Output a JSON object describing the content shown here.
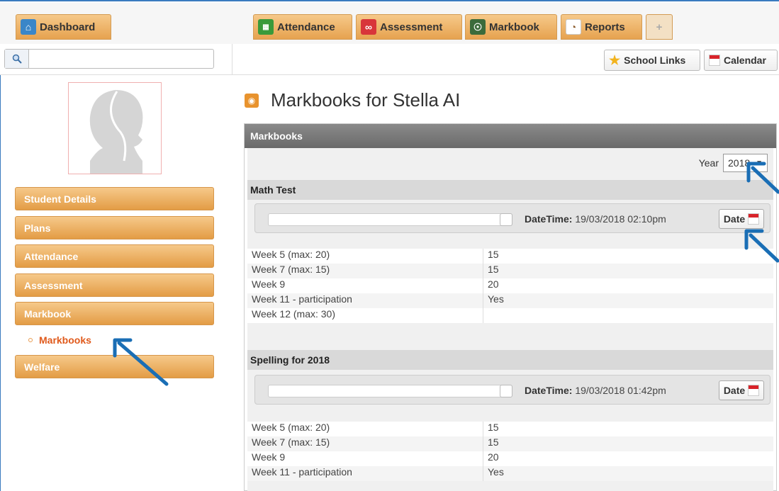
{
  "nav": {
    "dashboard": "Dashboard",
    "attendance": "Attendance",
    "assessment": "Assessment",
    "markbook": "Markbook",
    "reports": "Reports",
    "plus": "+"
  },
  "toolbar": {
    "search_value": "",
    "school_links": "School Links",
    "calendar": "Calendar"
  },
  "sidebar": {
    "items": [
      "Student Details",
      "Plans",
      "Attendance",
      "Assessment",
      "Markbook",
      "Welfare"
    ],
    "sub_item": "Markbooks"
  },
  "main": {
    "title": "Markbooks for Stella AI",
    "panel_title": "Markbooks",
    "year_label": "Year",
    "year_value": "2018",
    "markbooks": [
      {
        "title": "Math Test",
        "datetime_label": "DateTime:",
        "datetime_value": "19/03/2018 02:10pm",
        "date_button": "Date",
        "rows": [
          [
            "Week 5 (max: 20)",
            "15"
          ],
          [
            "Week 7 (max: 15)",
            "15"
          ],
          [
            "Week 9",
            "20"
          ],
          [
            "Week 11 - participation",
            "Yes"
          ],
          [
            "Week 12 (max: 30)",
            ""
          ]
        ]
      },
      {
        "title": "Spelling for 2018",
        "datetime_label": "DateTime:",
        "datetime_value": "19/03/2018 01:42pm",
        "date_button": "Date",
        "rows": [
          [
            "Week 5 (max: 20)",
            "15"
          ],
          [
            "Week 7 (max: 15)",
            "15"
          ],
          [
            "Week 9",
            "20"
          ],
          [
            "Week 11 - participation",
            "Yes"
          ]
        ]
      }
    ]
  },
  "colors": {
    "accent_orange": "#e6a24f",
    "active_link": "#e05a1c",
    "panel_header": "#6a6a6a",
    "arrow_blue": "#1a6eb5"
  }
}
